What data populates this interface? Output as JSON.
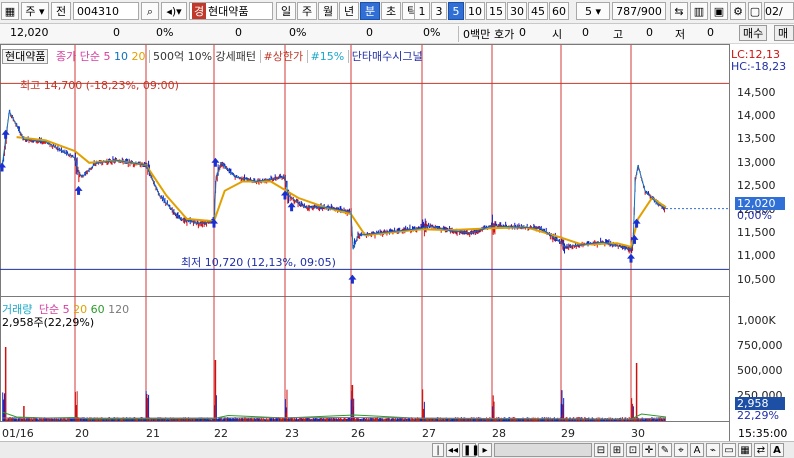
{
  "toolbar": {
    "market": "주",
    "period_prefix": "전",
    "code": "004310",
    "market_badge": "경",
    "stock_name": "현대약품",
    "intervals": [
      "일",
      "주",
      "월",
      "년",
      "분",
      "초",
      "틱"
    ],
    "selected_interval": "분",
    "minutes": [
      "1",
      "3",
      "5",
      "10",
      "15",
      "30",
      "45",
      "60"
    ],
    "selected_minute": "5",
    "count_select": "5",
    "page_count": "787",
    "page_total": "/900",
    "date_fragment": "02/"
  },
  "inforow": {
    "price": "12,020",
    "v1": "0",
    "v1p": "0%",
    "v2": "0",
    "v2p": "0%",
    "v3": "0",
    "v3p": "0%",
    "amount": "0백만",
    "bid_label": "호가",
    "bid": "0",
    "open_label": "시",
    "open": "0",
    "high_label": "고",
    "high": "0",
    "low_label": "저",
    "low": "0",
    "buy_button": "매수",
    "sell_button": "매도"
  },
  "legend_top": {
    "stock": "현대약품",
    "ma_label": "종가 단순",
    "ma_periods": [
      "5",
      "10",
      "20"
    ],
    "pattern": "500억 10% 강세패턴",
    "limit_up": "#상한가",
    "pct": "#15%",
    "signal": "단타매수시그널",
    "lc": "LC:12,13",
    "hc": "HC:-18,23"
  },
  "annotations": {
    "high": "최고 14,700 (-18,23%, 09:00)",
    "low": "최저 10,720 (12,13%, 09:05)"
  },
  "price_axis": {
    "ticks": [
      "14,500",
      "14,000",
      "13,500",
      "13,000",
      "12,500",
      "12,000",
      "11,500",
      "11,000",
      "10,500"
    ],
    "current_price": "12,020",
    "current_pct": "0,00%"
  },
  "legend_volume": {
    "label": "거래량",
    "ma_label": "단순",
    "periods": [
      "5",
      "20",
      "60",
      "120"
    ],
    "info": "2,958주(22,29%)"
  },
  "volume_axis": {
    "ticks": [
      "1,000K",
      "750,000",
      "500,000",
      "250,000"
    ],
    "current": "2,958",
    "current_pct": "22,29%"
  },
  "date_axis": {
    "labels": [
      "01/16",
      "20",
      "21",
      "22",
      "23",
      "26",
      "27",
      "28",
      "29",
      "30"
    ],
    "time": "15:35:00"
  },
  "colors": {
    "up": "#d01010",
    "down": "#1020c0",
    "ma5": "#d43da0",
    "ma10": "#1070c0",
    "ma20": "#e0a000",
    "ma60": "#2a9b2a",
    "vol_ma120": "#7a7a7a",
    "day_separator": "#d23a3a",
    "high_line": "#c0392b",
    "low_line": "#1f2fa8",
    "price_tag": "#2f6fd6",
    "vol_tag": "#1d4fa5"
  },
  "chart_data": {
    "type": "candlestick-intraday",
    "interval_minutes": 5,
    "days": [
      "01/16",
      "20",
      "21",
      "22",
      "23",
      "26",
      "27",
      "28",
      "29",
      "30"
    ],
    "close_path": [
      [
        0,
        12900
      ],
      [
        0.1,
        14100
      ],
      [
        0.3,
        13500
      ],
      [
        0.6,
        13450
      ],
      [
        1,
        13100
      ],
      [
        1.05,
        12800
      ],
      [
        1.1,
        12700
      ],
      [
        1.3,
        13000
      ],
      [
        1.6,
        13050
      ],
      [
        2,
        12950
      ],
      [
        2.05,
        12800
      ],
      [
        2.2,
        12300
      ],
      [
        2.5,
        11800
      ],
      [
        2.8,
        11700
      ],
      [
        3,
        11750
      ],
      [
        3.03,
        12700
      ],
      [
        3.1,
        13000
      ],
      [
        3.3,
        12700
      ],
      [
        3.6,
        12600
      ],
      [
        4,
        12700
      ],
      [
        4.05,
        12300
      ],
      [
        4.3,
        12050
      ],
      [
        4.6,
        12050
      ],
      [
        5,
        11950
      ],
      [
        5.03,
        11150
      ],
      [
        5.1,
        11450
      ],
      [
        5.4,
        11500
      ],
      [
        5.7,
        11550
      ],
      [
        6,
        11600
      ],
      [
        6.1,
        11650
      ],
      [
        6.4,
        11550
      ],
      [
        6.7,
        11500
      ],
      [
        7,
        11650
      ],
      [
        7.05,
        11650
      ],
      [
        7.4,
        11620
      ],
      [
        7.7,
        11600
      ],
      [
        8,
        11300
      ],
      [
        8.05,
        11200
      ],
      [
        8.3,
        11250
      ],
      [
        8.6,
        11300
      ],
      [
        9,
        11150
      ],
      [
        9.03,
        11250
      ],
      [
        9.06,
        12600
      ],
      [
        9.1,
        12950
      ],
      [
        9.2,
        12400
      ],
      [
        9.4,
        12100
      ],
      [
        9.5,
        12020
      ]
    ],
    "ma20_path": [
      [
        0.2,
        13550
      ],
      [
        0.6,
        13480
      ],
      [
        1,
        13250
      ],
      [
        1.2,
        13000
      ],
      [
        1.6,
        13050
      ],
      [
        2,
        12950
      ],
      [
        2.3,
        12300
      ],
      [
        2.6,
        11800
      ],
      [
        3,
        11750
      ],
      [
        3.15,
        12400
      ],
      [
        3.4,
        12600
      ],
      [
        3.8,
        12600
      ],
      [
        4.2,
        12250
      ],
      [
        4.6,
        12050
      ],
      [
        5,
        11900
      ],
      [
        5.2,
        11450
      ],
      [
        5.5,
        11500
      ],
      [
        6,
        11580
      ],
      [
        6.4,
        11560
      ],
      [
        7,
        11600
      ],
      [
        7.5,
        11620
      ],
      [
        8,
        11400
      ],
      [
        8.3,
        11250
      ],
      [
        8.8,
        11280
      ],
      [
        9,
        11200
      ],
      [
        9.1,
        11800
      ],
      [
        9.3,
        12250
      ],
      [
        9.5,
        12050
      ]
    ],
    "volume_spikes": [
      [
        0.05,
        740000
      ],
      [
        0.3,
        150000
      ],
      [
        1.02,
        160000
      ],
      [
        2.02,
        140000
      ],
      [
        3.02,
        610000
      ],
      [
        4.02,
        80000
      ],
      [
        5.02,
        360000
      ],
      [
        6.02,
        120000
      ],
      [
        7.02,
        100000
      ],
      [
        8.02,
        60000
      ],
      [
        9.02,
        110000
      ],
      [
        9.08,
        580000
      ]
    ],
    "high": 14700,
    "low": 10720,
    "last": 12020,
    "y_range": [
      10300,
      14900
    ],
    "volume_range": [
      0,
      1150000
    ],
    "buy_signals": [
      [
        0.0,
        12900
      ],
      [
        0.05,
        13600
      ],
      [
        1.05,
        12400
      ],
      [
        3.0,
        11700
      ],
      [
        3.02,
        13000
      ],
      [
        4.0,
        12300
      ],
      [
        4.1,
        12050
      ],
      [
        5.02,
        10500
      ],
      [
        9.0,
        10950
      ],
      [
        9.05,
        11350
      ],
      [
        9.08,
        11700
      ]
    ]
  }
}
